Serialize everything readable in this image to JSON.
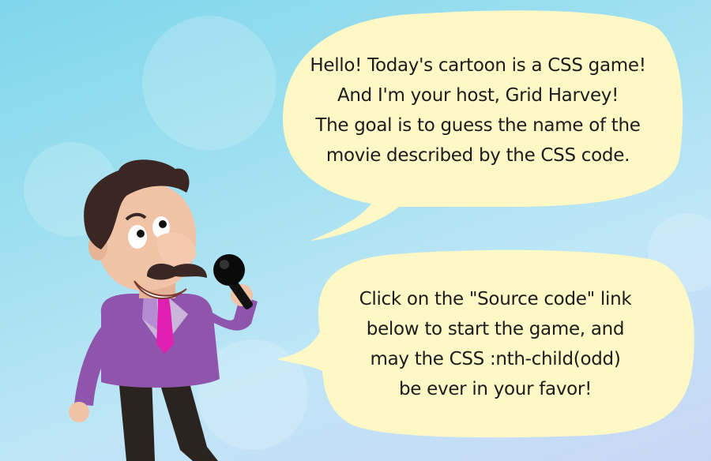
{
  "bubble_top": {
    "lines": [
      "Hello! Today's cartoon is a CSS game!",
      "And I'm your host, Grid Harvey!",
      "The goal is to guess the name of the",
      "movie described by the CSS code."
    ]
  },
  "bubble_bottom": {
    "lines": [
      "Click on the \"Source code\" link",
      "below to start the game, and",
      "may the CSS :nth-child(odd)",
      "be ever in your favor!"
    ]
  },
  "colors": {
    "bubble_fill": "#fdf8c6",
    "suit": "#8f54ab",
    "tie": "#e020b0",
    "skin": "#f0c3a6",
    "hair": "#3a2724"
  }
}
